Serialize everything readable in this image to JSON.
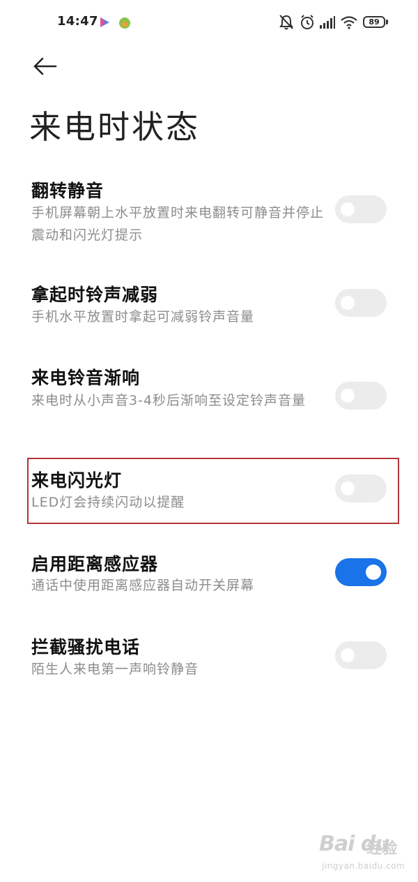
{
  "status_bar": {
    "time": "14:47",
    "battery": "89",
    "icons": [
      "play-app-icon",
      "green-app-icon",
      "bell-muted-icon",
      "alarm-icon",
      "signal-icon",
      "wifi-icon",
      "battery-icon"
    ]
  },
  "header": {
    "back_icon": "arrow-left-icon",
    "title": "来电时状态"
  },
  "settings": [
    {
      "title": "翻转静音",
      "description": "手机屏幕朝上水平放置时来电翻转可静音并停止震动和闪光灯提示",
      "enabled": false
    },
    {
      "title": "拿起时铃声减弱",
      "description": "手机水平放置时拿起可减弱铃声音量",
      "enabled": false
    },
    {
      "title": "来电铃音渐响",
      "description": "来电时从小声音3-4秒后渐响至设定铃声音量",
      "enabled": false
    },
    {
      "title": "来电闪光灯",
      "description": "LED灯会持续闪动以提醒",
      "enabled": false,
      "highlighted": true
    },
    {
      "title": "启用距离感应器",
      "description": "通话中使用距离感应器自动开关屏幕",
      "enabled": true
    },
    {
      "title": "拦截骚扰电话",
      "description": "陌生人来电第一声响铃静音",
      "enabled": false
    }
  ],
  "colors": {
    "toggle_on": "#1a73e8",
    "toggle_off": "#ececec",
    "highlight_border": "#b3343a",
    "description_text": "#8c8c8c"
  },
  "watermark": {
    "logo": "Bai du",
    "text": "经验",
    "url": "jingyan.baidu.com"
  }
}
